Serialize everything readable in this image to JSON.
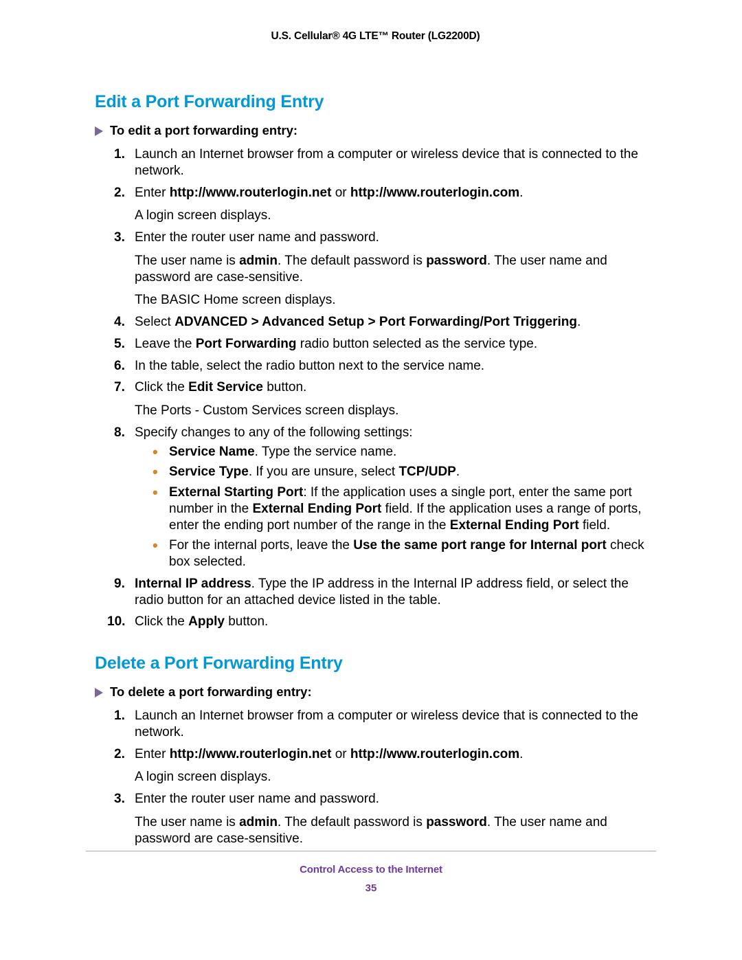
{
  "header": {
    "title": "U.S. Cellular® 4G LTE™ Router (LG2200D)"
  },
  "footer": {
    "section": "Control Access to the Internet",
    "page": "35"
  },
  "sections": [
    {
      "heading": "Edit a Port Forwarding Entry",
      "intro": "To edit a port forwarding entry:",
      "steps": [
        {
          "segs": [
            {
              "t": "Launch an Internet browser from a computer or wireless device that is connected to the network."
            }
          ]
        },
        {
          "segs": [
            {
              "t": "Enter "
            },
            {
              "t": "http://www.routerlogin.net",
              "b": true
            },
            {
              "t": " or "
            },
            {
              "t": "http://www.routerlogin.com",
              "b": true
            },
            {
              "t": "."
            }
          ],
          "subs": [
            {
              "segs": [
                {
                  "t": "A login screen displays."
                }
              ]
            }
          ]
        },
        {
          "segs": [
            {
              "t": "Enter the router user name and password."
            }
          ],
          "subs": [
            {
              "segs": [
                {
                  "t": "The user name is "
                },
                {
                  "t": "admin",
                  "b": true
                },
                {
                  "t": ". The default password is "
                },
                {
                  "t": "password",
                  "b": true
                },
                {
                  "t": ". The user name and password are case-sensitive."
                }
              ]
            },
            {
              "segs": [
                {
                  "t": "The BASIC Home screen displays."
                }
              ]
            }
          ]
        },
        {
          "segs": [
            {
              "t": "Select "
            },
            {
              "t": "ADVANCED > Advanced Setup > Port Forwarding/Port Triggering",
              "b": true
            },
            {
              "t": "."
            }
          ]
        },
        {
          "segs": [
            {
              "t": "Leave the "
            },
            {
              "t": "Port Forwarding",
              "b": true
            },
            {
              "t": " radio button selected as the service type."
            }
          ]
        },
        {
          "segs": [
            {
              "t": "In the table, select the radio button next to the service name."
            }
          ]
        },
        {
          "segs": [
            {
              "t": "Click the "
            },
            {
              "t": "Edit Service",
              "b": true
            },
            {
              "t": " button."
            }
          ],
          "subs": [
            {
              "segs": [
                {
                  "t": "The Ports - Custom Services screen displays."
                }
              ]
            }
          ]
        },
        {
          "segs": [
            {
              "t": "Specify changes to any of the following settings:"
            }
          ],
          "bullets": [
            {
              "segs": [
                {
                  "t": "Service Name",
                  "b": true
                },
                {
                  "t": ". Type the service name."
                }
              ]
            },
            {
              "segs": [
                {
                  "t": "Service Type",
                  "b": true
                },
                {
                  "t": ". If you are unsure, select "
                },
                {
                  "t": "TCP/UDP",
                  "b": true
                },
                {
                  "t": "."
                }
              ]
            },
            {
              "segs": [
                {
                  "t": "External Starting Port",
                  "b": true
                },
                {
                  "t": ": If the application uses a single port, enter the same port number in the "
                },
                {
                  "t": "External Ending Port",
                  "b": true
                },
                {
                  "t": " field. If the application uses a range of ports, enter the ending port number of the range in the "
                },
                {
                  "t": "External Ending Port",
                  "b": true
                },
                {
                  "t": " field."
                }
              ]
            },
            {
              "segs": [
                {
                  "t": "For the internal ports, leave the "
                },
                {
                  "t": "Use the same port range for Internal port",
                  "b": true
                },
                {
                  "t": " check box selected."
                }
              ]
            }
          ]
        },
        {
          "segs": [
            {
              "t": "Internal IP address",
              "b": true
            },
            {
              "t": ". Type the IP address in the Internal IP address field, or select the radio button for an attached device listed in the table."
            }
          ]
        },
        {
          "n10": true,
          "segs": [
            {
              "t": "Click the "
            },
            {
              "t": "Apply",
              "b": true
            },
            {
              "t": " button."
            }
          ]
        }
      ]
    },
    {
      "heading": "Delete a Port Forwarding Entry",
      "intro": "To delete a port forwarding entry:",
      "steps": [
        {
          "segs": [
            {
              "t": "Launch an Internet browser from a computer or wireless device that is connected to the network."
            }
          ]
        },
        {
          "segs": [
            {
              "t": "Enter "
            },
            {
              "t": "http://www.routerlogin.net",
              "b": true
            },
            {
              "t": " or "
            },
            {
              "t": "http://www.routerlogin.com",
              "b": true
            },
            {
              "t": "."
            }
          ],
          "subs": [
            {
              "segs": [
                {
                  "t": "A login screen displays."
                }
              ]
            }
          ]
        },
        {
          "segs": [
            {
              "t": "Enter the router user name and password."
            }
          ],
          "subs": [
            {
              "segs": [
                {
                  "t": "The user name is "
                },
                {
                  "t": "admin",
                  "b": true
                },
                {
                  "t": ". The default password is "
                },
                {
                  "t": "password",
                  "b": true
                },
                {
                  "t": ". The user name and password are case-sensitive."
                }
              ]
            }
          ]
        }
      ]
    }
  ]
}
